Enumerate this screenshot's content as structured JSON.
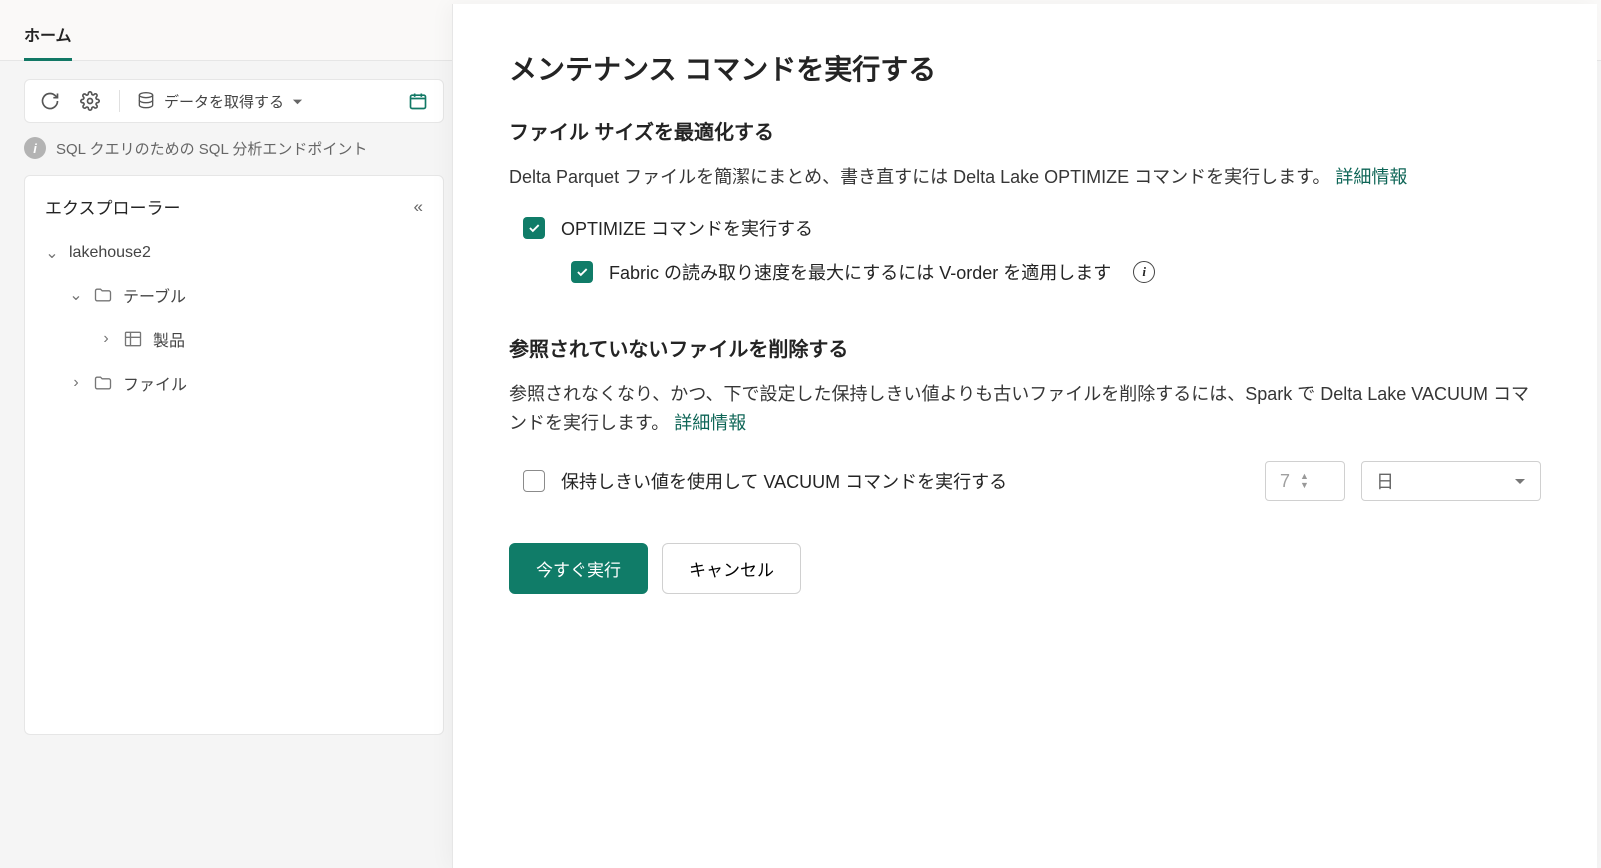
{
  "tabbar": {
    "home": "ホーム"
  },
  "toolbar": {
    "get_data": "データを取得する"
  },
  "status": {
    "text": "SQL クエリのための SQL 分析エンドポイント"
  },
  "explorer": {
    "title": "エクスプローラー",
    "root": "lakehouse2",
    "tables": "テーブル",
    "product": "製品",
    "files": "ファイル"
  },
  "dialog": {
    "title": "メンテナンス コマンドを実行する",
    "optimize_heading": "ファイル サイズを最適化する",
    "optimize_desc": "Delta Parquet ファイルを簡潔にまとめ、書き直すには Delta Lake OPTIMIZE コマンドを実行します。 ",
    "learn_more": "詳細情報",
    "opt_run": "OPTIMIZE コマンドを実行する",
    "opt_vorder": "Fabric の読み取り速度を最大にするには V-order を適用します",
    "vacuum_heading": "参照されていないファイルを削除する",
    "vacuum_desc": "参照されなくなり、かつ、下で設定した保持しきい値よりも古いファイルを削除するには、Spark で Delta Lake VACUUM コマンドを実行します。 ",
    "vacuum_chk": "保持しきい値を使用して VACUUM コマンドを実行する",
    "retention_value": "7",
    "retention_unit": "日",
    "run_now": "今すぐ実行",
    "cancel": "キャンセル"
  }
}
